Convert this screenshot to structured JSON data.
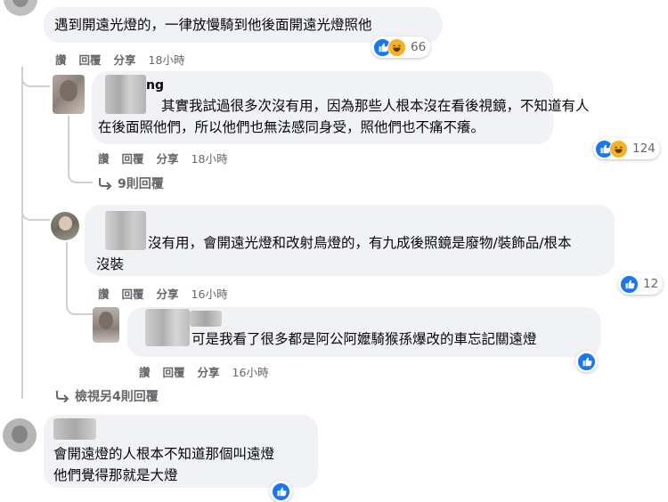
{
  "comments": [
    {
      "id": "c1",
      "author_fragment": "",
      "text_lines": [
        "遇到開遠光燈的，一律放慢騎到他後面開遠光燈照他"
      ],
      "actions": {
        "like": "讚",
        "reply": "回覆",
        "share": "分享",
        "time": "18小時"
      },
      "reactions": {
        "types": [
          "like-icon",
          "haha-icon"
        ],
        "count": "66"
      }
    },
    {
      "id": "c2",
      "author_fragment": "ng",
      "text_lines": [
        "其實我試過很多次沒有用，因為那些人根本沒在看後視鏡，不知道有人",
        "在後面照他們，所以他們也無法感同身受，照他們也不痛不癢。"
      ],
      "actions": {
        "like": "讚",
        "reply": "回覆",
        "share": "分享",
        "time": "18小時"
      },
      "reactions": {
        "types": [
          "like-icon",
          "haha-icon"
        ],
        "count": "124"
      },
      "more_replies": "9則回覆"
    },
    {
      "id": "c3",
      "author_fragment": "",
      "text_lines": [
        "沒有用，會開遠光燈和改射鳥燈的，有九成後照鏡是廢物/裝飾品/根本",
        "沒裝"
      ],
      "actions": {
        "like": "讚",
        "reply": "回覆",
        "share": "分享",
        "time": "16小時"
      },
      "reactions": {
        "types": [
          "like-icon"
        ],
        "count": "12"
      }
    },
    {
      "id": "c4",
      "author_fragment": "",
      "text_lines": [
        "可是我看了很多都是阿公阿嬤騎猴孫爆改的車忘記關遠燈"
      ],
      "actions": {
        "like": "讚",
        "reply": "回覆",
        "share": "分享",
        "time": "16小時"
      },
      "reactions": {
        "types": [
          "like-icon"
        ],
        "count": ""
      }
    },
    {
      "id": "c5",
      "author_fragment": "",
      "text_lines": [
        "會開遠燈的人根本不知道那個叫遠燈",
        "他們覺得那就是大燈"
      ],
      "actions": null,
      "reactions": {
        "types": [
          "like-icon"
        ],
        "count": ""
      }
    }
  ],
  "view_more_replies": "檢視另4則回覆",
  "colors": {
    "bubble": "#f0f2f5",
    "like_blue": "#1877f2",
    "haha_yellow": "#f7b125",
    "secondary_text": "#65676b",
    "thread_line": "#ccd0d5"
  }
}
